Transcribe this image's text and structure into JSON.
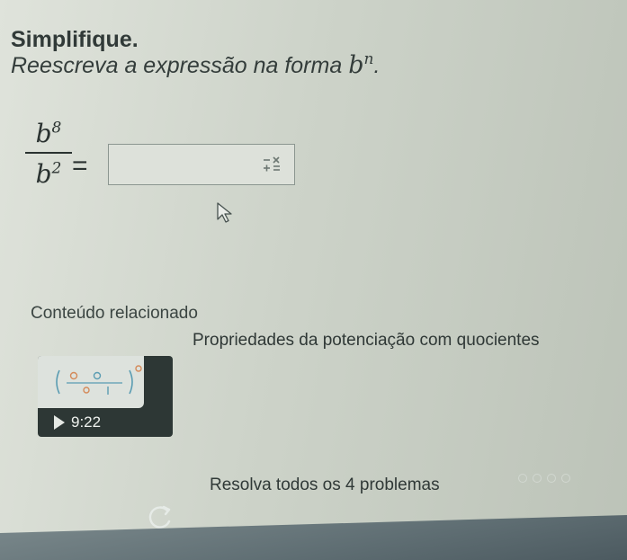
{
  "exercise": {
    "title": "Simplifique.",
    "prompt": "Reescreva a expressão na forma",
    "form_base": "b",
    "form_exponent": "n",
    "form_period": ".",
    "numerator_base": "b",
    "numerator_exponent": "8",
    "denominator_base": "b",
    "denominator_exponent": "2",
    "equals": "=",
    "answer_value": ""
  },
  "related": {
    "heading": "Conteúdo relacionado",
    "video_title": "Propriedades da potenciação com quocientes",
    "duration": "9:22"
  },
  "practice": {
    "label": "Resolva todos os 4 problemas",
    "total": 4,
    "completed": 0
  },
  "colors": {
    "background": "#c9cfc6",
    "text": "#2f3836",
    "thumbnail": "#2d3735",
    "accent": "#4c8fa6"
  },
  "icons": [
    "math-keyboard-icon",
    "mouse-cursor-icon",
    "play-icon",
    "retry-icon"
  ]
}
